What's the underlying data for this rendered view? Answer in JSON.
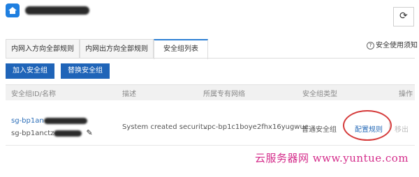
{
  "tabs": [
    {
      "label": "内网入方向全部规则"
    },
    {
      "label": "内网出方向全部规则"
    },
    {
      "label": "安全组列表"
    }
  ],
  "help_link": "安全使用须知",
  "buttons": {
    "join": "加入安全组",
    "replace": "替换安全组"
  },
  "table": {
    "headers": [
      "安全组ID/名称",
      "描述",
      "所属专有网络",
      "安全组类型",
      "操作"
    ],
    "row": {
      "id_prefix": "sg-bp1an",
      "name_prefix": "sg-bp1anctz",
      "description": "System created securit...",
      "vpc": "vpc-bp1c1boye2fhx16yugwue",
      "type": "普通安全组",
      "action_config": "配置规则",
      "action_remove": "移出"
    }
  },
  "watermark": "云服务器网 www.yuntue.com",
  "colors": {
    "primary": "#1f64b8",
    "tab_accent": "#2d7fd4",
    "link": "#2a6db8",
    "annotation": "#d53a3a",
    "watermark": "#d42b8a"
  }
}
